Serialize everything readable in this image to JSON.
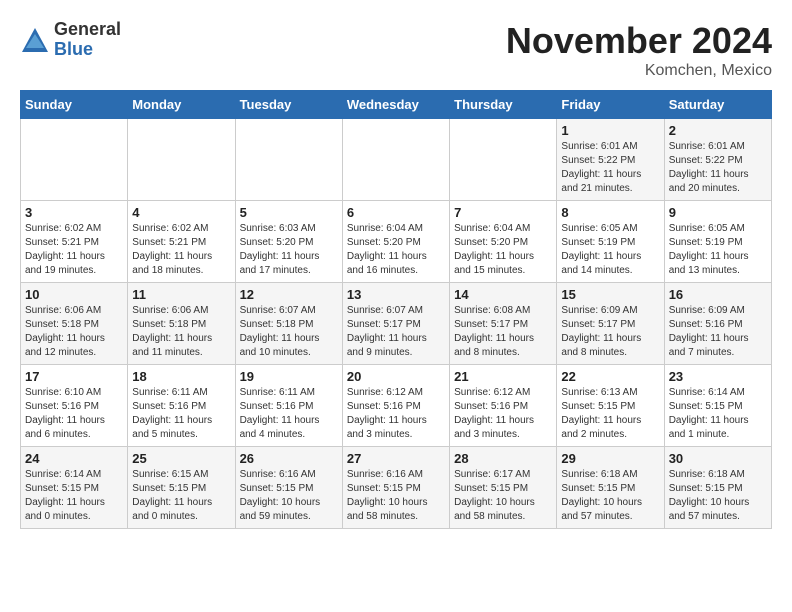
{
  "header": {
    "logo_line1": "General",
    "logo_line2": "Blue",
    "month": "November 2024",
    "location": "Komchen, Mexico"
  },
  "weekdays": [
    "Sunday",
    "Monday",
    "Tuesday",
    "Wednesday",
    "Thursday",
    "Friday",
    "Saturday"
  ],
  "weeks": [
    [
      {
        "day": "",
        "info": ""
      },
      {
        "day": "",
        "info": ""
      },
      {
        "day": "",
        "info": ""
      },
      {
        "day": "",
        "info": ""
      },
      {
        "day": "",
        "info": ""
      },
      {
        "day": "1",
        "info": "Sunrise: 6:01 AM\nSunset: 5:22 PM\nDaylight: 11 hours\nand 21 minutes."
      },
      {
        "day": "2",
        "info": "Sunrise: 6:01 AM\nSunset: 5:22 PM\nDaylight: 11 hours\nand 20 minutes."
      }
    ],
    [
      {
        "day": "3",
        "info": "Sunrise: 6:02 AM\nSunset: 5:21 PM\nDaylight: 11 hours\nand 19 minutes."
      },
      {
        "day": "4",
        "info": "Sunrise: 6:02 AM\nSunset: 5:21 PM\nDaylight: 11 hours\nand 18 minutes."
      },
      {
        "day": "5",
        "info": "Sunrise: 6:03 AM\nSunset: 5:20 PM\nDaylight: 11 hours\nand 17 minutes."
      },
      {
        "day": "6",
        "info": "Sunrise: 6:04 AM\nSunset: 5:20 PM\nDaylight: 11 hours\nand 16 minutes."
      },
      {
        "day": "7",
        "info": "Sunrise: 6:04 AM\nSunset: 5:20 PM\nDaylight: 11 hours\nand 15 minutes."
      },
      {
        "day": "8",
        "info": "Sunrise: 6:05 AM\nSunset: 5:19 PM\nDaylight: 11 hours\nand 14 minutes."
      },
      {
        "day": "9",
        "info": "Sunrise: 6:05 AM\nSunset: 5:19 PM\nDaylight: 11 hours\nand 13 minutes."
      }
    ],
    [
      {
        "day": "10",
        "info": "Sunrise: 6:06 AM\nSunset: 5:18 PM\nDaylight: 11 hours\nand 12 minutes."
      },
      {
        "day": "11",
        "info": "Sunrise: 6:06 AM\nSunset: 5:18 PM\nDaylight: 11 hours\nand 11 minutes."
      },
      {
        "day": "12",
        "info": "Sunrise: 6:07 AM\nSunset: 5:18 PM\nDaylight: 11 hours\nand 10 minutes."
      },
      {
        "day": "13",
        "info": "Sunrise: 6:07 AM\nSunset: 5:17 PM\nDaylight: 11 hours\nand 9 minutes."
      },
      {
        "day": "14",
        "info": "Sunrise: 6:08 AM\nSunset: 5:17 PM\nDaylight: 11 hours\nand 8 minutes."
      },
      {
        "day": "15",
        "info": "Sunrise: 6:09 AM\nSunset: 5:17 PM\nDaylight: 11 hours\nand 8 minutes."
      },
      {
        "day": "16",
        "info": "Sunrise: 6:09 AM\nSunset: 5:16 PM\nDaylight: 11 hours\nand 7 minutes."
      }
    ],
    [
      {
        "day": "17",
        "info": "Sunrise: 6:10 AM\nSunset: 5:16 PM\nDaylight: 11 hours\nand 6 minutes."
      },
      {
        "day": "18",
        "info": "Sunrise: 6:11 AM\nSunset: 5:16 PM\nDaylight: 11 hours\nand 5 minutes."
      },
      {
        "day": "19",
        "info": "Sunrise: 6:11 AM\nSunset: 5:16 PM\nDaylight: 11 hours\nand 4 minutes."
      },
      {
        "day": "20",
        "info": "Sunrise: 6:12 AM\nSunset: 5:16 PM\nDaylight: 11 hours\nand 3 minutes."
      },
      {
        "day": "21",
        "info": "Sunrise: 6:12 AM\nSunset: 5:16 PM\nDaylight: 11 hours\nand 3 minutes."
      },
      {
        "day": "22",
        "info": "Sunrise: 6:13 AM\nSunset: 5:15 PM\nDaylight: 11 hours\nand 2 minutes."
      },
      {
        "day": "23",
        "info": "Sunrise: 6:14 AM\nSunset: 5:15 PM\nDaylight: 11 hours\nand 1 minute."
      }
    ],
    [
      {
        "day": "24",
        "info": "Sunrise: 6:14 AM\nSunset: 5:15 PM\nDaylight: 11 hours\nand 0 minutes."
      },
      {
        "day": "25",
        "info": "Sunrise: 6:15 AM\nSunset: 5:15 PM\nDaylight: 11 hours\nand 0 minutes."
      },
      {
        "day": "26",
        "info": "Sunrise: 6:16 AM\nSunset: 5:15 PM\nDaylight: 10 hours\nand 59 minutes."
      },
      {
        "day": "27",
        "info": "Sunrise: 6:16 AM\nSunset: 5:15 PM\nDaylight: 10 hours\nand 58 minutes."
      },
      {
        "day": "28",
        "info": "Sunrise: 6:17 AM\nSunset: 5:15 PM\nDaylight: 10 hours\nand 58 minutes."
      },
      {
        "day": "29",
        "info": "Sunrise: 6:18 AM\nSunset: 5:15 PM\nDaylight: 10 hours\nand 57 minutes."
      },
      {
        "day": "30",
        "info": "Sunrise: 6:18 AM\nSunset: 5:15 PM\nDaylight: 10 hours\nand 57 minutes."
      }
    ]
  ]
}
